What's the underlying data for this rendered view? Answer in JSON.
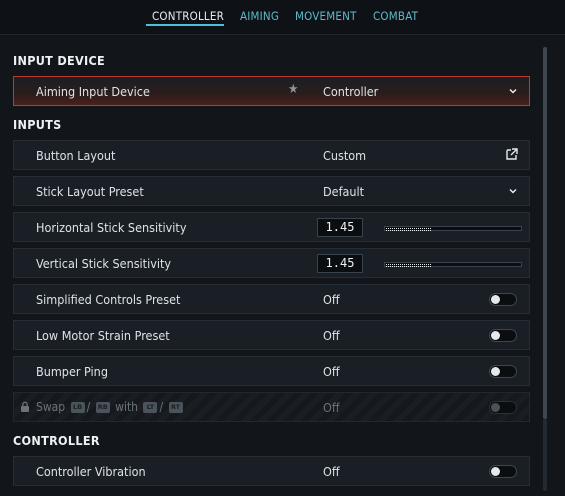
{
  "tabs": [
    {
      "label": "CONTROLLER",
      "active": true
    },
    {
      "label": "AIMING",
      "active": false
    },
    {
      "label": "MOVEMENT",
      "active": false
    },
    {
      "label": "COMBAT",
      "active": false
    }
  ],
  "sections": {
    "input_device": "INPUT DEVICE",
    "inputs": "INPUTS",
    "controller": "CONTROLLER"
  },
  "rows": {
    "aiming_input_device": {
      "label": "Aiming Input Device",
      "value": "Controller",
      "icon": "star-icon"
    },
    "button_layout": {
      "label": "Button Layout",
      "value": "Custom",
      "icon": "external-link-icon"
    },
    "stick_layout_preset": {
      "label": "Stick Layout Preset",
      "value": "Default"
    },
    "horizontal_sensitivity": {
      "label": "Horizontal Stick Sensitivity",
      "value": "1.45",
      "slider_fraction": 0.33
    },
    "vertical_sensitivity": {
      "label": "Vertical Stick Sensitivity",
      "value": "1.45",
      "slider_fraction": 0.33
    },
    "simplified_controls": {
      "label": "Simplified Controls Preset",
      "value": "Off"
    },
    "low_motor_strain": {
      "label": "Low Motor Strain Preset",
      "value": "Off"
    },
    "bumper_ping": {
      "label": "Bumper Ping",
      "value": "Off"
    },
    "swap": {
      "prefix": "Swap",
      "sep1": "/",
      "with": "with",
      "sep2": "/",
      "glyph_lb": "LB",
      "glyph_rb": "RB",
      "glyph_lt": "LT",
      "glyph_rt": "RT",
      "value": "Off"
    },
    "controller_vibration": {
      "label": "Controller Vibration",
      "value": "Off"
    }
  },
  "colors": {
    "accent": "#4cc0d4",
    "highlight_border": "#c0382a"
  }
}
